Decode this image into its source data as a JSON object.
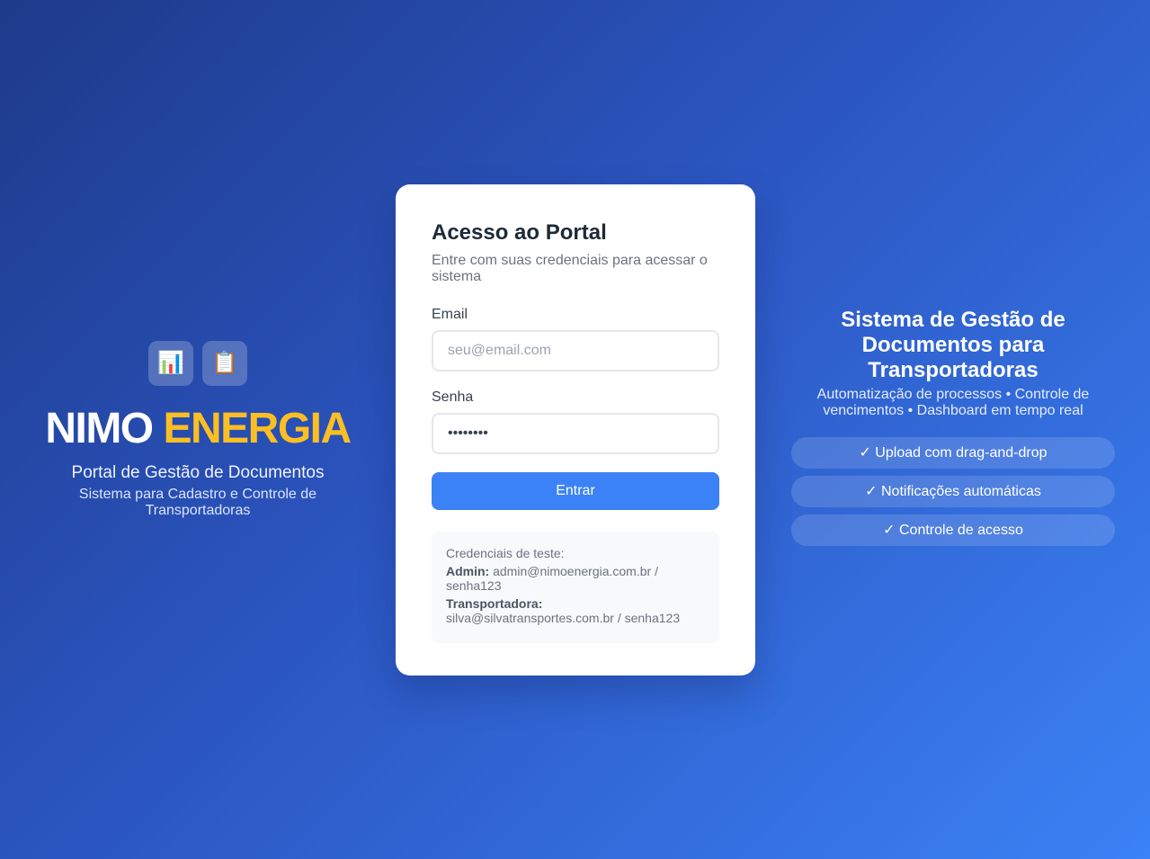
{
  "brand": {
    "icons": [
      {
        "name": "bar-chart-icon",
        "glyph": "📊"
      },
      {
        "name": "clipboard-icon",
        "glyph": "📋"
      }
    ],
    "title_part1": "NIMO ",
    "title_part2": "ENERGIA",
    "accent_color": "#fbbf24",
    "subtitle": "Portal de Gestão de Documentos",
    "description": "Sistema para Cadastro e Controle de Transportadoras"
  },
  "login": {
    "title": "Acesso ao Portal",
    "subtitle": "Entre com suas credenciais para acessar o sistema",
    "email_label": "Email",
    "email_placeholder": "seu@email.com",
    "email_value": "",
    "password_label": "Senha",
    "password_value": "••••••••",
    "submit_label": "Entrar",
    "button_color": "#3b82f6"
  },
  "test_credentials": {
    "title": "Credenciais de teste:",
    "admin_label": "Admin:",
    "admin_value": "admin@nimoenergia.com.br / senha123",
    "carrier_label": "Transportadora:",
    "carrier_value": "silva@silvatransportes.com.br / senha123"
  },
  "info": {
    "title": "Sistema de Gestão de Documentos para Transportadoras",
    "subtitle": "Automatização de processos • Controle de vencimentos • Dashboard em tempo real",
    "features": [
      "✓ Upload com drag-and-drop",
      "✓ Notificações automáticas",
      "✓ Controle de acesso"
    ]
  }
}
